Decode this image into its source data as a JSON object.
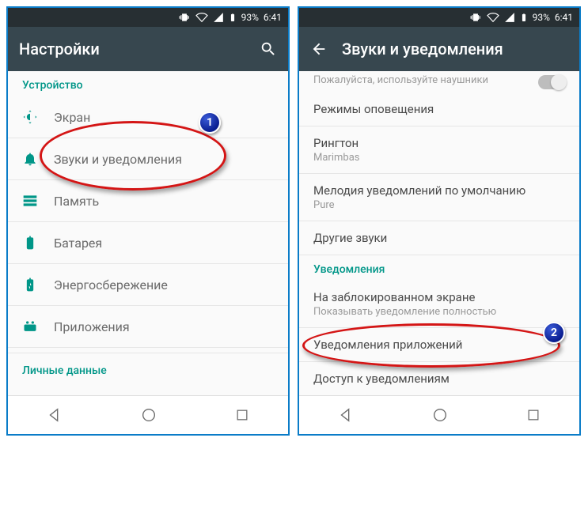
{
  "status": {
    "battery": "93%",
    "time": "6:41"
  },
  "left": {
    "title": "Настройки",
    "section_device": "Устройство",
    "items": [
      {
        "label": "Экран"
      },
      {
        "label": "Звуки и уведомления"
      },
      {
        "label": "Память"
      },
      {
        "label": "Батарея"
      },
      {
        "label": "Энергосбережение"
      },
      {
        "label": "Приложения"
      }
    ],
    "section_personal": "Личные данные",
    "callout": "1"
  },
  "right": {
    "title": "Звуки и уведомления",
    "hint": "Пожалуйста, используйте наушники",
    "items": [
      {
        "label": "Режимы оповещения"
      },
      {
        "label": "Рингтон",
        "sub": "Marimbas"
      },
      {
        "label": "Мелодия уведомлений по умолчанию",
        "sub": "Pure"
      },
      {
        "label": "Другие звуки"
      }
    ],
    "section_notif": "Уведомления",
    "notif_items": [
      {
        "label": "На заблокированном экране",
        "sub": "Показывать уведомление полностью"
      },
      {
        "label": "Уведомления приложений"
      },
      {
        "label": "Доступ к уведомлениям"
      }
    ],
    "callout": "2"
  }
}
